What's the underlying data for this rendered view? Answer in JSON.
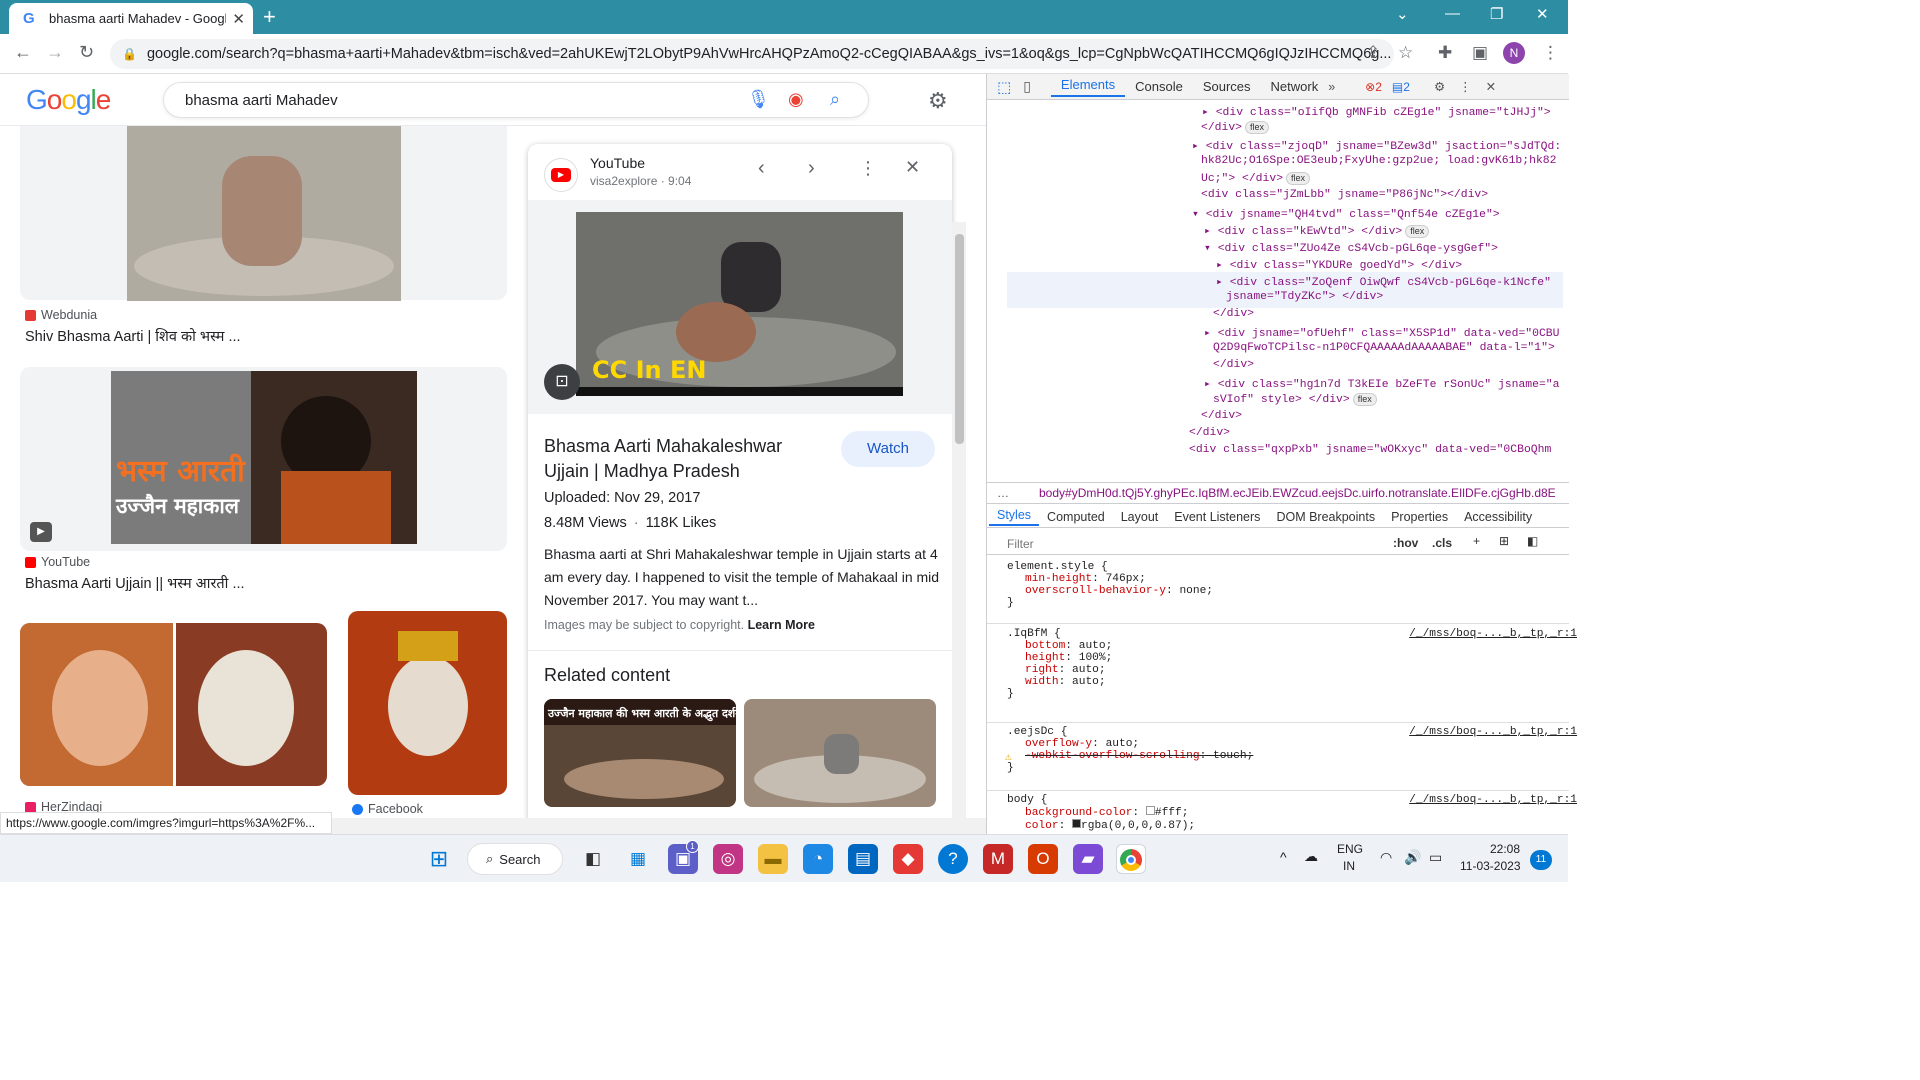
{
  "browser": {
    "tab_title": "bhasma aarti Mahadev - Google",
    "url": "google.com/search?q=bhasma+aarti+Mahadev&tbm=isch&ved=2ahUKEwjT2LObytP9AhVwHrcAHQPzAmoQ2-cCegQIABAA&gs_ivs=1&oq&gs_lcp=CgNpbWcQATIHCCMQ6gIQJzIHCCMQ6g...",
    "profile_initial": "N"
  },
  "google": {
    "logo": "Google",
    "search_query": "bhasma aarti Mahadev"
  },
  "results": [
    {
      "source": "Webdunia",
      "title": "Shiv Bhasma Aarti | शिव को भस्म ..."
    },
    {
      "source": "YouTube",
      "title": "Bhasma Aarti Ujjain || भस्म आरती ...",
      "thumb_text_1": "भस्म आरती",
      "thumb_text_2": "उज्जैन महाकाल"
    },
    {
      "source": "HerZindagi",
      "title": ""
    },
    {
      "source": "Facebook",
      "title": ""
    }
  ],
  "preview": {
    "site": "YouTube",
    "channel": "visa2explore · 9:04",
    "overlay_caption": "CC In EN",
    "title": "Bhasma Aarti Mahakaleshwar Ujjain | Madhya Pradesh",
    "watch_label": "Watch",
    "uploaded": "Uploaded: Nov 29, 2017",
    "views": "8.48M Views",
    "likes": "118K Likes",
    "description": "Bhasma aarti at Shri Mahakaleshwar temple in Ujjain starts at 4 am every day. I happened to visit the temple of Mahakaal in mid November 2017. You may want t...",
    "copyright": "Images may be subject to copyright.",
    "learn_more": "Learn More",
    "related_heading": "Related content",
    "related_1_caption": "उज्जैन महाकाल की भस्म आरती के अद्भुत दर्शन"
  },
  "status_url": "https://www.google.com/imgres?imgurl=https%3A%2F%...",
  "devtools": {
    "tabs": [
      "Elements",
      "Console",
      "Sources",
      "Network"
    ],
    "errors": "2",
    "messages": "2",
    "dom_lines": [
      "<div class=\"oIifQb gMNFib cZEg1e\" jsname=\"tJHJj\">",
      "</div>",
      "<div class=\"zjoqD\" jsname=\"BZew3d\" jsaction=\"sJdTQd:",
      "hk82Uc;O16Spe:OE3eub;FxyUhe:gzp2ue; load:gvK61b;hk82",
      "Uc;\"> </div>",
      "<div class=\"jZmLbb\" jsname=\"P86jNc\"></div>",
      "<div jsname=\"QH4tvd\" class=\"Qnf54e cZEg1e\">",
      "<div class=\"kEwVtd\"> </div>",
      "<div class=\"ZUo4Ze cS4Vcb-pGL6qe-ysgGef\">",
      "<div class=\"YKDURe goedYd\"> </div>",
      "<div class=\"ZoQenf OiwQwf cS4Vcb-pGL6qe-k1Ncfe\"",
      "jsname=\"TdyZKc\"> </div>",
      "</div>",
      "<div jsname=\"ofUehf\" class=\"X5SP1d\" data-ved=\"0CBU",
      "Q2D9qFwoTCPilsc-n1P0CFQAAAAAdAAAAABAE\" data-l=\"1\">",
      " </div>",
      "<div class=\"hg1n7d T3kEIe bZeFTe rSonUc\" jsname=\"a",
      "sVIof\" style> </div>",
      "</div>",
      "</div>",
      "<div class=\"qxpPxb\" jsname=\"wOKxyc\" data-ved=\"0CBoQhm"
    ],
    "breadcrumb": "body#yDmH0d.tQj5Y.ghyPEc.IqBfM.ecJEib.EWZcud.eejsDc.uirfo.notranslate.EIlDFe.cjGgHb.d8E",
    "style_tabs": [
      "Styles",
      "Computed",
      "Layout",
      "Event Listeners",
      "DOM Breakpoints",
      "Properties",
      "Accessibility"
    ],
    "filter_placeholder": "Filter",
    "hov": ":hov",
    "cls": ".cls",
    "rules": [
      {
        "selector": "element.style {",
        "props": [
          [
            "min-height",
            "746px;"
          ],
          [
            "overscroll-behavior-y",
            "none;"
          ]
        ],
        "source": ""
      },
      {
        "selector": ".IqBfM {",
        "props": [
          [
            "bottom",
            "auto;"
          ],
          [
            "height",
            "100%;"
          ],
          [
            "right",
            "auto;"
          ],
          [
            "width",
            "auto;"
          ]
        ],
        "source": "/_/mss/boq-..._b,_tp,_r:1"
      },
      {
        "selector": ".eejsDc {",
        "props": [
          [
            "overflow-y",
            "auto;"
          ],
          [
            "-webkit-overflow-scrolling",
            "touch;"
          ]
        ],
        "source": "/_/mss/boq-..._b,_tp,_r:1"
      },
      {
        "selector": "body {",
        "props": [
          [
            "background-color",
            "#fff;"
          ],
          [
            "color",
            "rgba(0,0,0,0.87);"
          ]
        ],
        "source": "/_/mss/boq-..._b,_tp,_r:1"
      }
    ]
  },
  "taskbar": {
    "search_label": "Search",
    "lang_1": "ENG",
    "lang_2": "IN",
    "time": "22:08",
    "date": "11-03-2023",
    "notif_count": "11",
    "chat_badge": "1"
  },
  "colors": {
    "titlebar": "#2d8ea3",
    "google_blue": "#4285f4",
    "watch_bg": "#e8f0fe",
    "youtube_red": "#ff0000"
  }
}
